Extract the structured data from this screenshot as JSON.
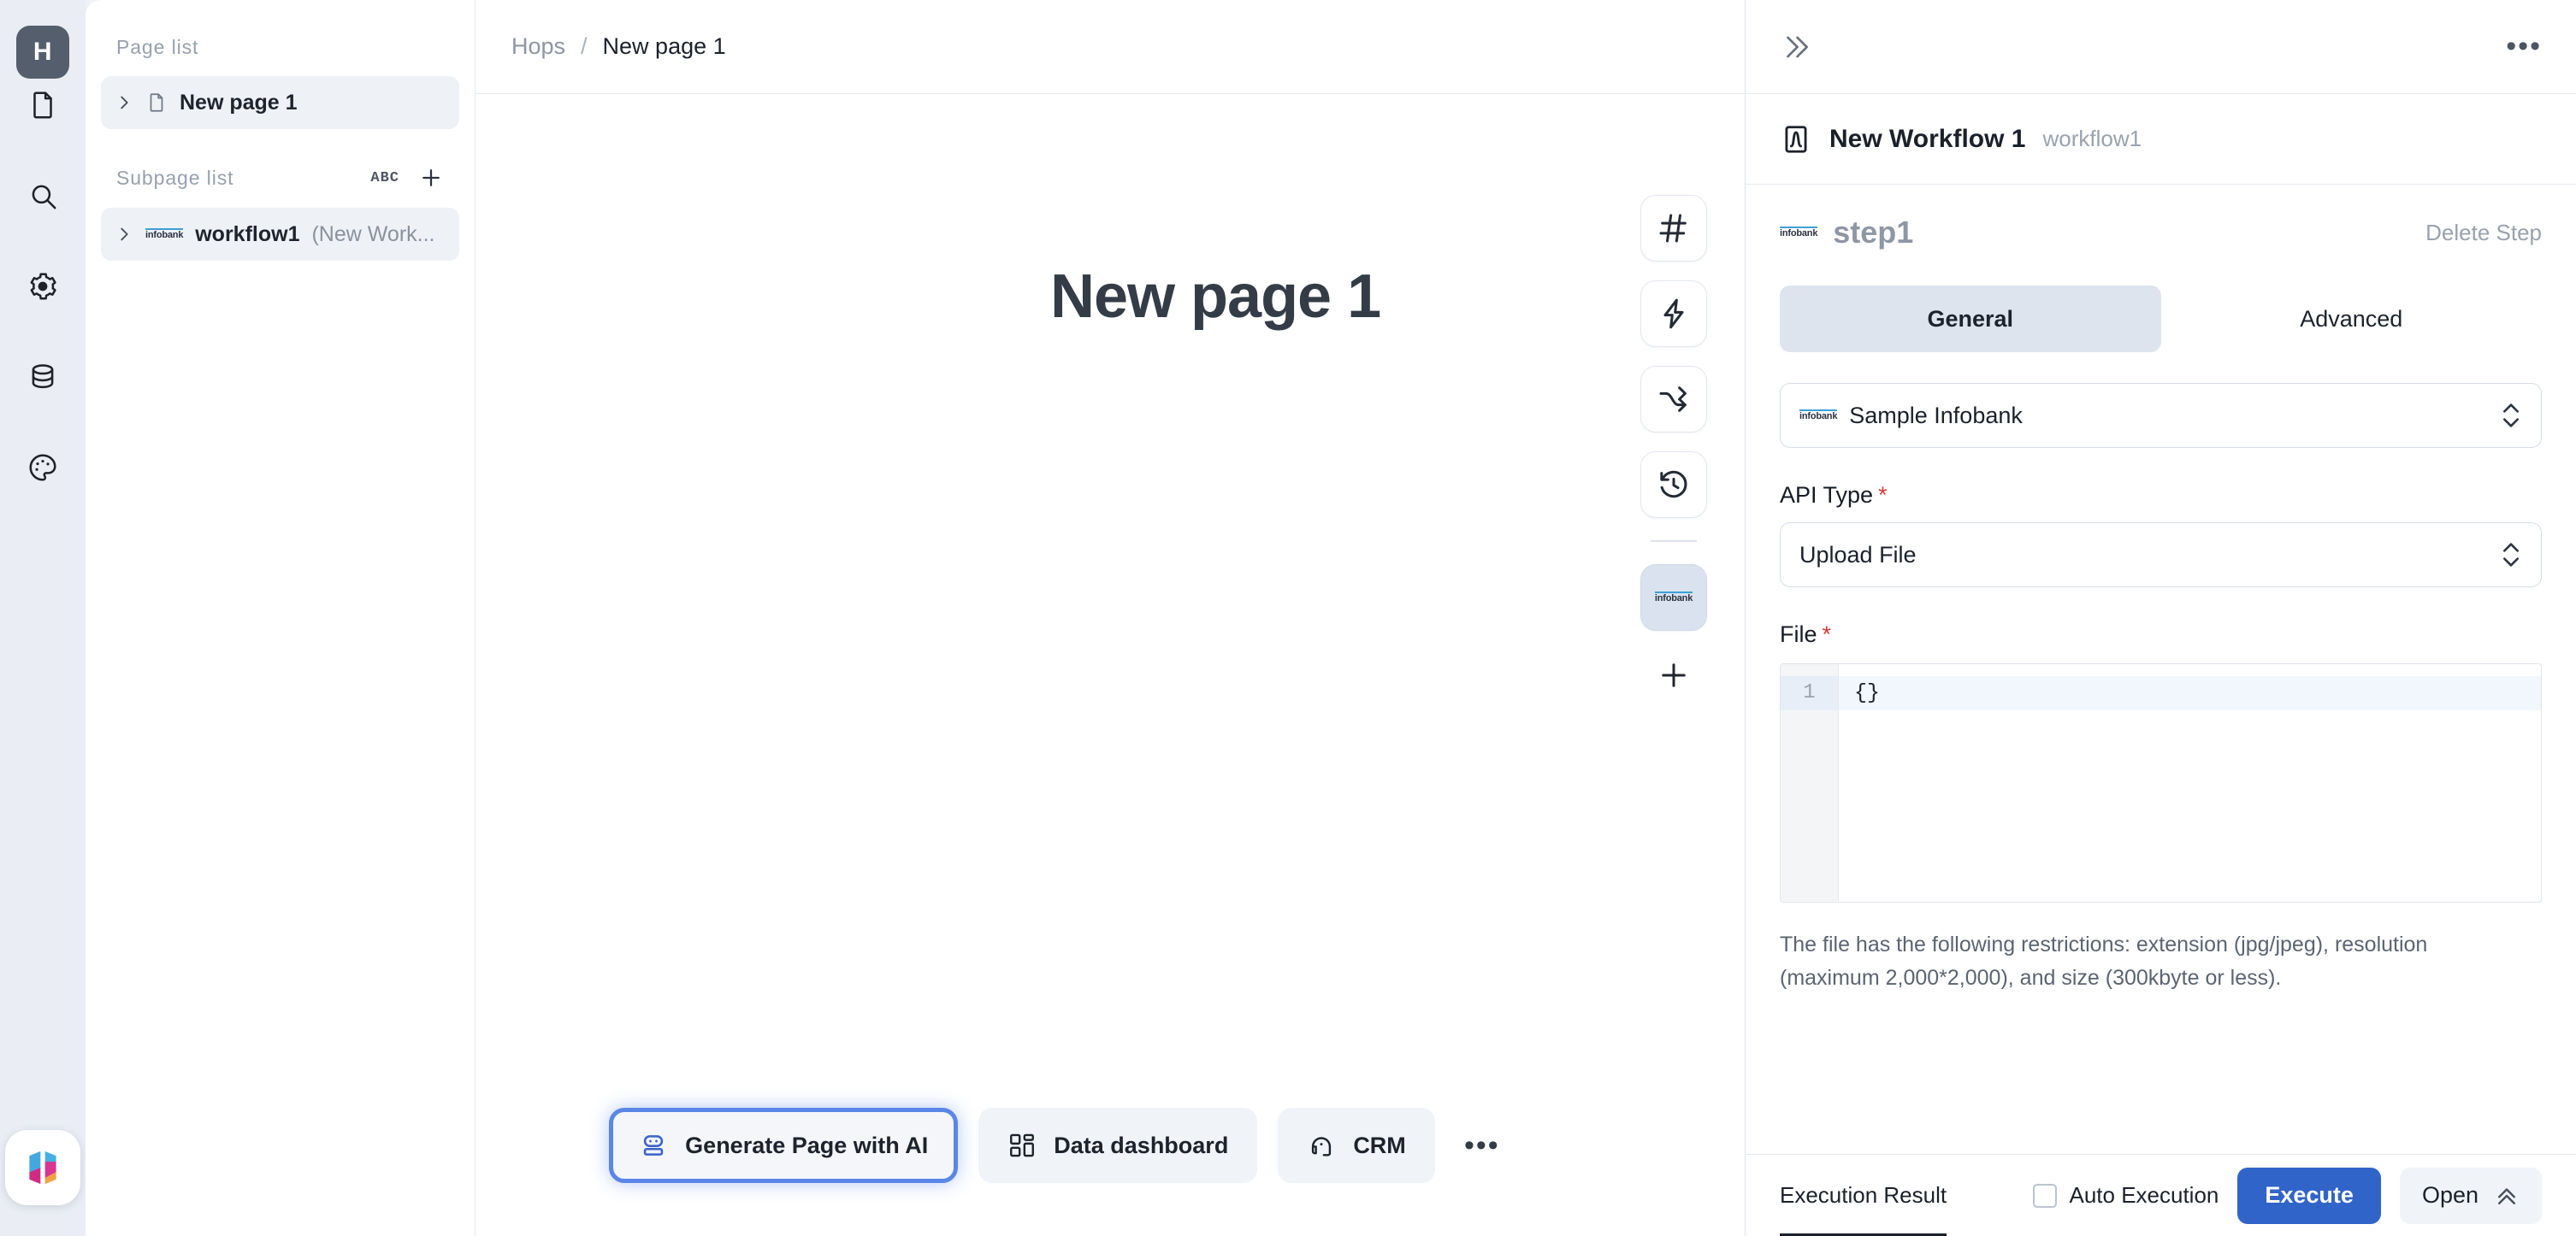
{
  "rail": {
    "avatar_label": "H",
    "icons": [
      {
        "name": "document-icon"
      },
      {
        "name": "search-icon"
      },
      {
        "name": "gear-icon"
      },
      {
        "name": "database-icon"
      },
      {
        "name": "palette-icon"
      }
    ],
    "logo_name": "hops-logo"
  },
  "page_panel": {
    "page_list_title": "Page list",
    "page_items": [
      {
        "label": "New page 1"
      }
    ],
    "subpage_list_title": "Subpage list",
    "sort_label": "ABC",
    "add_label": "+",
    "subpage_items": [
      {
        "badge": "infobank",
        "name": "workflow1",
        "suffix": " (New Work..."
      }
    ]
  },
  "breadcrumb": {
    "root": "Hops",
    "separator": "/",
    "current": "New page 1"
  },
  "canvas": {
    "page_title": "New page 1",
    "toolbar": [
      {
        "name": "hash-icon"
      },
      {
        "name": "lightning-icon"
      },
      {
        "name": "branch-icon"
      },
      {
        "name": "history-icon"
      }
    ],
    "toolbar_infobank_label": "infobank",
    "toolbar_add_label": "+",
    "actions": [
      {
        "label": "Generate Page with AI",
        "icon": "robot-icon",
        "highlighted": true
      },
      {
        "label": "Data dashboard",
        "icon": "dashboard-icon",
        "highlighted": false
      },
      {
        "label": "CRM",
        "icon": "crm-icon",
        "highlighted": false
      }
    ],
    "actions_more": "•••"
  },
  "right_panel": {
    "collapse_label": "»",
    "more_label": "•••",
    "workflow_title": "New Workflow 1",
    "workflow_id": "workflow1",
    "step_name": "step1",
    "step_badge": "infobank",
    "delete_step_label": "Delete Step",
    "tabs": [
      {
        "label": "General",
        "active": true
      },
      {
        "label": "Advanced",
        "active": false
      }
    ],
    "infobank_select": {
      "badge": "infobank",
      "value": "Sample Infobank"
    },
    "api_type": {
      "label": "API Type",
      "required": "*",
      "value": "Upload File"
    },
    "file": {
      "label": "File",
      "required": "*",
      "line_number": "1",
      "code": "{}",
      "hint": "The file has the following restrictions: extension (jpg/jpeg), resolution (maximum 2,000*2,000), and size (300kbyte or less)."
    },
    "bottom": {
      "result_tab": "Execution Result",
      "auto_execution_label": "Auto Execution",
      "execute_label": "Execute",
      "open_label": "Open"
    }
  },
  "colors": {
    "accent_blue": "#3064c9",
    "highlight_border": "#5a86e8",
    "rail_bg": "#eaeef4",
    "required_red": "#d23b34"
  }
}
